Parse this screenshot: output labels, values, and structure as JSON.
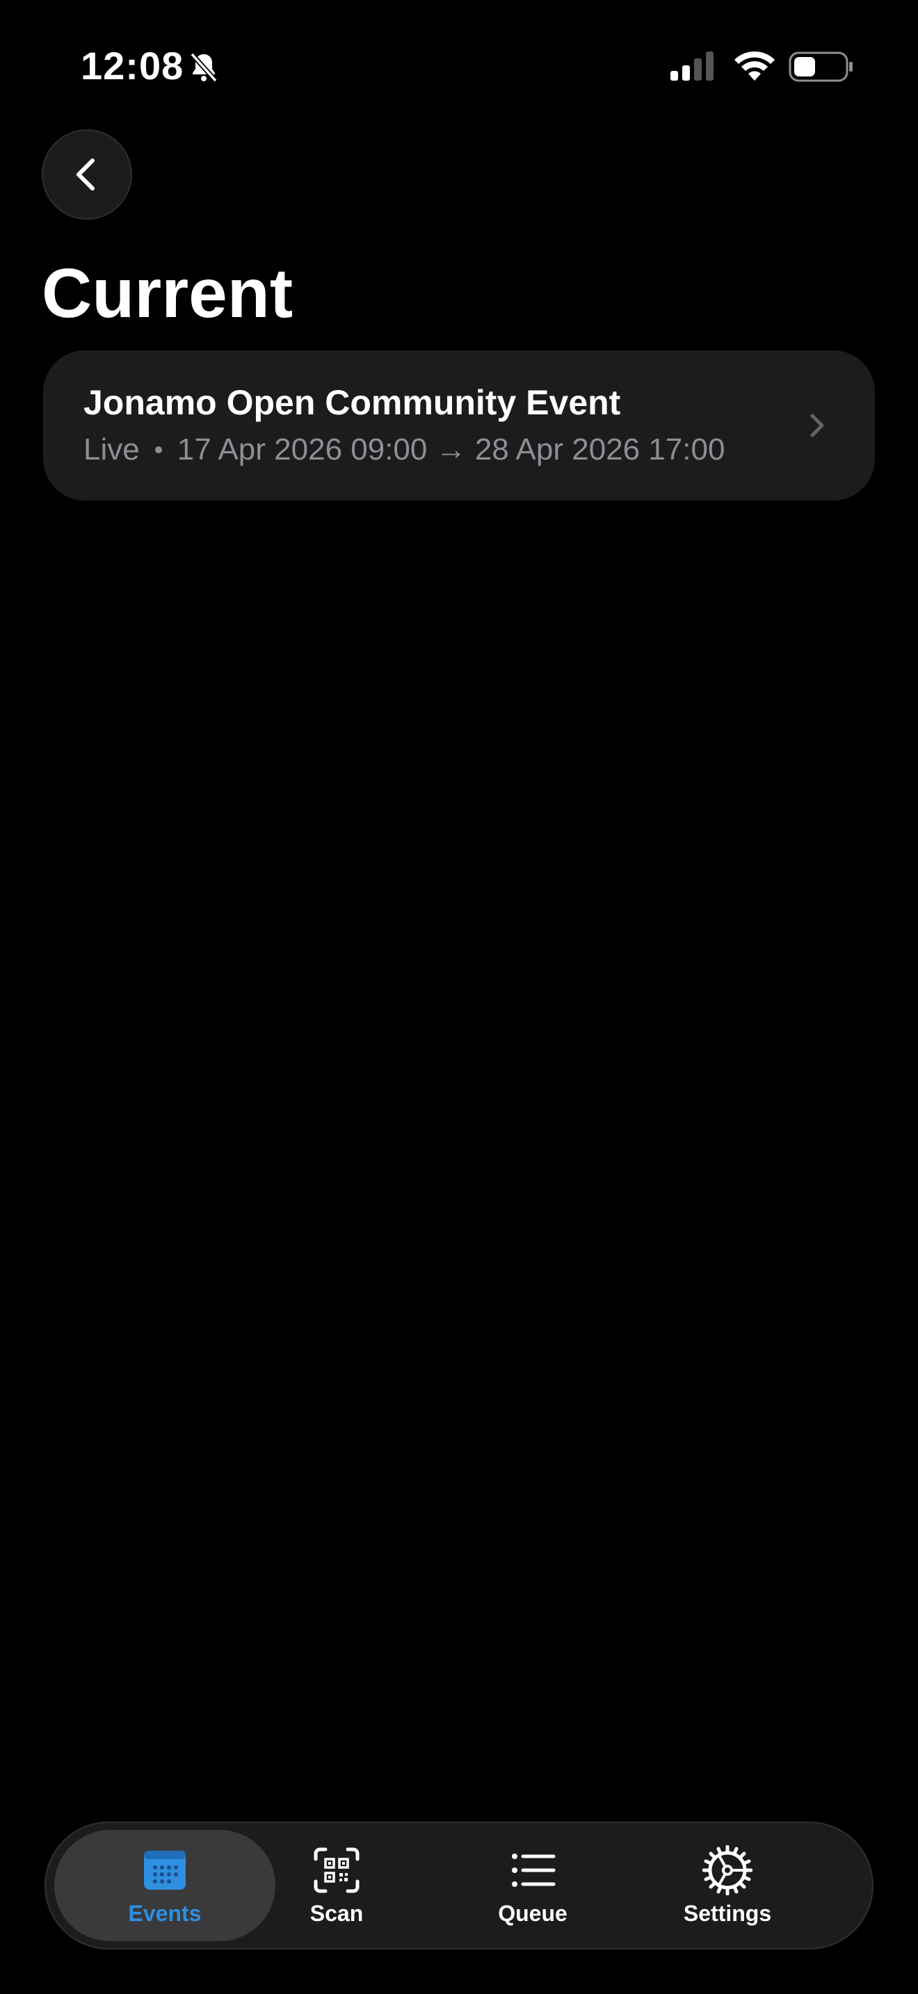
{
  "status_bar": {
    "time": "12:08",
    "icons": [
      "bell-slash-icon",
      "cellular-signal-icon",
      "wifi-icon",
      "battery-icon"
    ]
  },
  "navigation": {
    "back_icon": "chevron-left-icon"
  },
  "page": {
    "title": "Current"
  },
  "events": [
    {
      "title": "Jonamo Open Community Event",
      "status": "Live",
      "range": "17 Apr 2026 09:00 → 28 Apr 2026 17:00",
      "chevron_icon": "chevron-right-icon"
    }
  ],
  "tab_bar": {
    "active": "Events",
    "tabs": [
      {
        "label": "Events",
        "icon": "calendar-icon"
      },
      {
        "label": "Scan",
        "icon": "qr-scan-icon"
      },
      {
        "label": "Queue",
        "icon": "list-icon"
      },
      {
        "label": "Settings",
        "icon": "gear-icon"
      }
    ]
  },
  "colors": {
    "background": "#000000",
    "card": "#1c1c1e",
    "secondary_text": "#8e8e93",
    "accent": "#2f8fe0"
  }
}
